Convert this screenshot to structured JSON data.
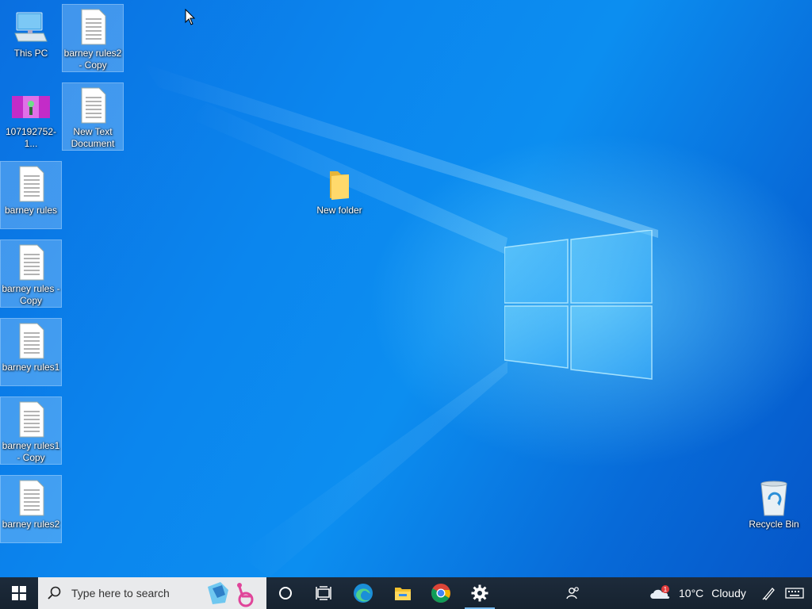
{
  "desktop": {
    "icons": [
      {
        "name": "this-pc",
        "label": "This PC",
        "type": "computer",
        "selected": false
      },
      {
        "name": "barney-rules2-copy",
        "label": "barney rules2\n- Copy",
        "type": "textfile",
        "selected": true
      },
      {
        "name": "image-file",
        "label": "107192752-1...",
        "type": "image",
        "selected": false
      },
      {
        "name": "new-text-document",
        "label": "New Text\nDocument",
        "type": "textfile",
        "selected": true
      },
      {
        "name": "barney-rules",
        "label": "barney rules",
        "type": "textfile",
        "selected": true
      },
      {
        "name": "new-folder",
        "label": "New folder",
        "type": "folder",
        "selected": false
      },
      {
        "name": "barney-rules-copy",
        "label": "barney rules -\nCopy",
        "type": "textfile",
        "selected": true
      },
      {
        "name": "barney-rules1",
        "label": "barney rules1",
        "type": "textfile",
        "selected": true
      },
      {
        "name": "barney-rules1-copy",
        "label": "barney rules1\n- Copy",
        "type": "textfile",
        "selected": true
      },
      {
        "name": "barney-rules2",
        "label": "barney rules2",
        "type": "textfile",
        "selected": true
      },
      {
        "name": "recycle-bin",
        "label": "Recycle Bin",
        "type": "recycle",
        "selected": false
      }
    ]
  },
  "taskbar": {
    "search_placeholder": "Type here to search",
    "pinned": [
      {
        "name": "cortana",
        "icon": "circle-icon"
      },
      {
        "name": "task-view",
        "icon": "task-view-icon"
      },
      {
        "name": "edge",
        "icon": "edge-icon"
      },
      {
        "name": "file-explorer",
        "icon": "folder-icon"
      },
      {
        "name": "chrome",
        "icon": "chrome-icon"
      },
      {
        "name": "settings",
        "icon": "gear-icon",
        "active": true
      }
    ],
    "weather": {
      "temp": "10°C",
      "condition": "Cloudy",
      "badge": "1"
    },
    "colors": {
      "taskbar_bg": "#1b2a3a",
      "accent": "#76b9ed",
      "desktop_blue": "#0b86ee"
    }
  }
}
